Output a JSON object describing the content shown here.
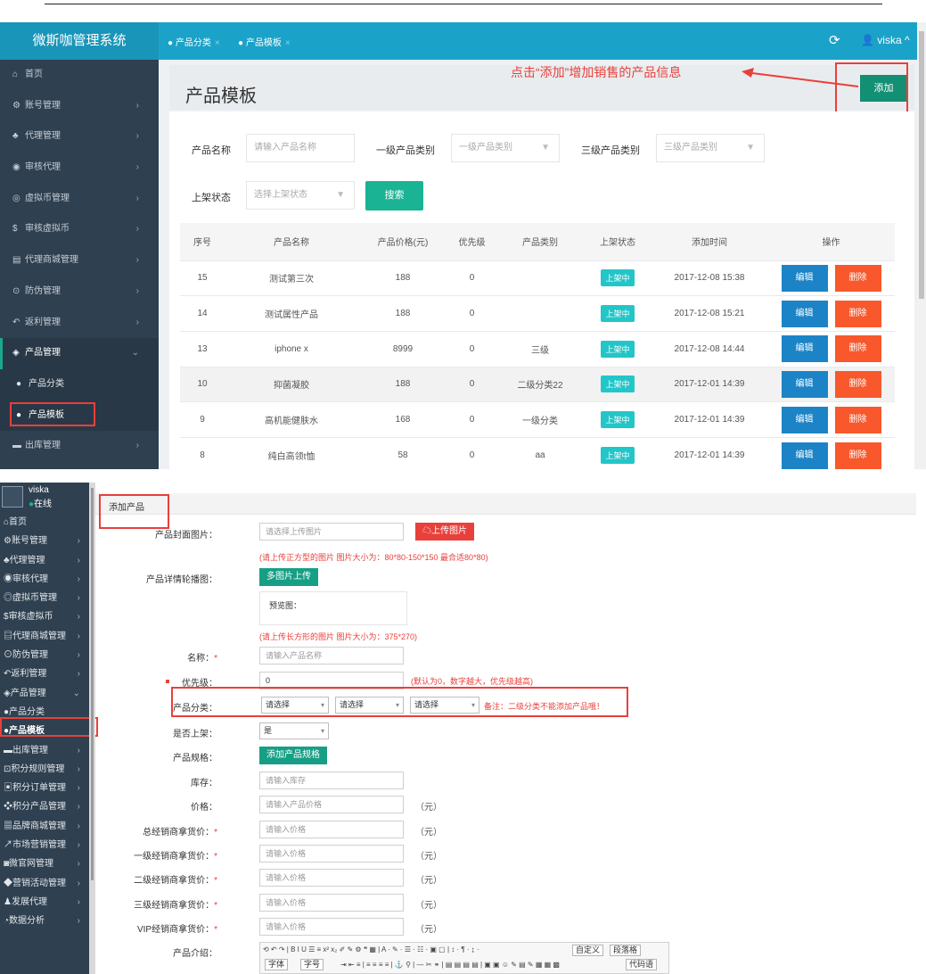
{
  "screen1": {
    "brand": "微斯咖管理系统",
    "tabs": [
      {
        "label": "产品分类",
        "close": "×"
      },
      {
        "label": "产品模板",
        "close": "×"
      }
    ],
    "user": "viska",
    "sidebar": [
      {
        "icon": "home-icon",
        "label": "首页",
        "chevron": ""
      },
      {
        "icon": "gears-icon",
        "label": "账号管理",
        "chevron": "›"
      },
      {
        "icon": "sitemap-icon",
        "label": "代理管理",
        "chevron": "›"
      },
      {
        "icon": "eye-icon",
        "label": "审核代理",
        "chevron": "›"
      },
      {
        "icon": "coin-icon",
        "label": "虚拟币管理",
        "chevron": "›"
      },
      {
        "icon": "dollar-icon",
        "label": "审核虚拟币",
        "chevron": "›"
      },
      {
        "icon": "file-icon",
        "label": "代理商城管理",
        "chevron": "›"
      },
      {
        "icon": "shield-icon",
        "label": "防伪管理",
        "chevron": "›"
      },
      {
        "icon": "reply-icon",
        "label": "返利管理",
        "chevron": "›"
      },
      {
        "icon": "cube-icon",
        "label": "产品管理",
        "chevron": "⌄"
      },
      {
        "icon": "circle-icon",
        "label": "产品分类",
        "chevron": ""
      },
      {
        "icon": "circle-icon",
        "label": "产品模板",
        "chevron": ""
      },
      {
        "icon": "box-icon",
        "label": "出库管理",
        "chevron": "›"
      }
    ],
    "page_title": "产品模板",
    "hint": "点击“添加”增加销售的产品信息",
    "add_label": "添加",
    "filters": {
      "name_label": "产品名称",
      "name_placeholder": "请输入产品名称",
      "cat1_label": "一级产品类别",
      "cat1_placeholder": "一级产品类别",
      "cat3_label": "三级产品类别",
      "cat3_placeholder": "三级产品类别",
      "status_label": "上架状态",
      "status_placeholder": "选择上架状态",
      "search_label": "搜索"
    },
    "table": {
      "headers": [
        "序号",
        "产品名称",
        "产品价格(元)",
        "优先级",
        "产品类别",
        "上架状态",
        "添加时间",
        "操作"
      ],
      "rows": [
        {
          "id": "15",
          "name": "测试第三次",
          "price": "188",
          "priority": "0",
          "category": "",
          "status": "上架中",
          "time": "2017-12-08 15:38"
        },
        {
          "id": "14",
          "name": "测试属性产品",
          "price": "188",
          "priority": "0",
          "category": "",
          "status": "上架中",
          "time": "2017-12-08 15:21"
        },
        {
          "id": "13",
          "name": "iphone x",
          "price": "8999",
          "priority": "0",
          "category": "三级",
          "status": "上架中",
          "time": "2017-12-08 14:44"
        },
        {
          "id": "10",
          "name": "抑菌凝胶",
          "price": "188",
          "priority": "0",
          "category": "二级分类22",
          "status": "上架中",
          "time": "2017-12-01 14:39"
        },
        {
          "id": "9",
          "name": "高机能健肤水",
          "price": "168",
          "priority": "0",
          "category": "一级分类",
          "status": "上架中",
          "time": "2017-12-01 14:39"
        },
        {
          "id": "8",
          "name": "纯白高领t恤",
          "price": "58",
          "priority": "0",
          "category": "aa",
          "status": "上架中",
          "time": "2017-12-01 14:39"
        }
      ],
      "edit_label": "编辑",
      "delete_label": "删除"
    }
  },
  "screen2": {
    "user": "viska",
    "online": "在线",
    "sidebar": [
      {
        "label": "首页",
        "icon": "home-icon",
        "chevron": ""
      },
      {
        "label": "账号管理",
        "icon": "gears-icon",
        "chevron": "›"
      },
      {
        "label": "代理管理",
        "icon": "sitemap-icon",
        "chevron": "›"
      },
      {
        "label": "审核代理",
        "icon": "eye-icon",
        "chevron": "›"
      },
      {
        "label": "虚拟币管理",
        "icon": "coin-icon",
        "chevron": "›"
      },
      {
        "label": "审核虚拟币",
        "icon": "dollar-icon",
        "chevron": "›"
      },
      {
        "label": "代理商城管理",
        "icon": "file-icon",
        "chevron": "›"
      },
      {
        "label": "防伪管理",
        "icon": "shield-icon",
        "chevron": "›"
      },
      {
        "label": "返利管理",
        "icon": "reply-icon",
        "chevron": "›"
      },
      {
        "label": "产品管理",
        "icon": "cube-icon",
        "chevron": "⌄"
      },
      {
        "label": "产品分类",
        "icon": "circle-icon",
        "chevron": ""
      },
      {
        "label": "产品模板",
        "icon": "circle-icon",
        "chevron": ""
      },
      {
        "label": "出库管理",
        "icon": "box-icon",
        "chevron": "›"
      },
      {
        "label": "积分规则管理",
        "icon": "rule-icon",
        "chevron": "›"
      },
      {
        "label": "积分订单管理",
        "icon": "order-icon",
        "chevron": "›"
      },
      {
        "label": "积分产品管理",
        "icon": "gift-icon",
        "chevron": "›"
      },
      {
        "label": "品牌商城管理",
        "icon": "shop-icon",
        "chevron": "›"
      },
      {
        "label": "市场营销管理",
        "icon": "chart-icon",
        "chevron": "›"
      },
      {
        "label": "微官网管理",
        "icon": "web-icon",
        "chevron": "›"
      },
      {
        "label": "营销活动管理",
        "icon": "tag-icon",
        "chevron": "›"
      },
      {
        "label": "发展代理",
        "icon": "users-icon",
        "chevron": "›"
      },
      {
        "label": "数据分析",
        "icon": "pie-icon",
        "chevron": "›"
      }
    ],
    "tab_title": "添加产品",
    "form": {
      "cover_label": "产品封面图片：",
      "cover_placeholder": "请选择上传图片",
      "upload_label": "上传图片",
      "cover_note": "(请上传正方型的图片 图片大小为：80*80-150*150 最合适80*80)",
      "carousel_label": "产品详情轮播图：",
      "multi_upload_label": "多图片上传",
      "preview_label": "预览图：",
      "carousel_note": "(请上传长方形的图片 图片大小为：375*270)",
      "name_label": "名称：",
      "name_placeholder": "请输入产品名称",
      "priority_label": "优先级：",
      "priority_value": "0",
      "priority_note": "(默认为0，数字越大，优先级越高)",
      "category_label": "产品分类：",
      "select_placeholder": "请选择",
      "category_note": "备注：二级分类不能添加产品哦！",
      "onshelf_label": "是否上架：",
      "onshelf_value": "是",
      "spec_label": "产品规格：",
      "add_spec_label": "添加产品规格",
      "stock_label": "库存：",
      "stock_placeholder": "请输入库存",
      "price_label": "价格：",
      "price_placeholder": "请输入产品价格",
      "unit": "（元）",
      "price_fields": [
        {
          "label": "总经销商拿货价：",
          "placeholder": "请输入价格"
        },
        {
          "label": "一级经销商拿货价：",
          "placeholder": "请输入价格"
        },
        {
          "label": "二级经销商拿货价：",
          "placeholder": "请输入价格"
        },
        {
          "label": "三级经销商拿货价：",
          "placeholder": "请输入价格"
        },
        {
          "label": "VIP经销商拿货价：",
          "placeholder": "请输入价格"
        }
      ],
      "intro_label": "产品介绍：",
      "required_mark": "*",
      "editor": {
        "font": "字体",
        "size": "字号",
        "custom": "自定义",
        "paragraph": "段落格",
        "code": "代码语"
      }
    }
  }
}
